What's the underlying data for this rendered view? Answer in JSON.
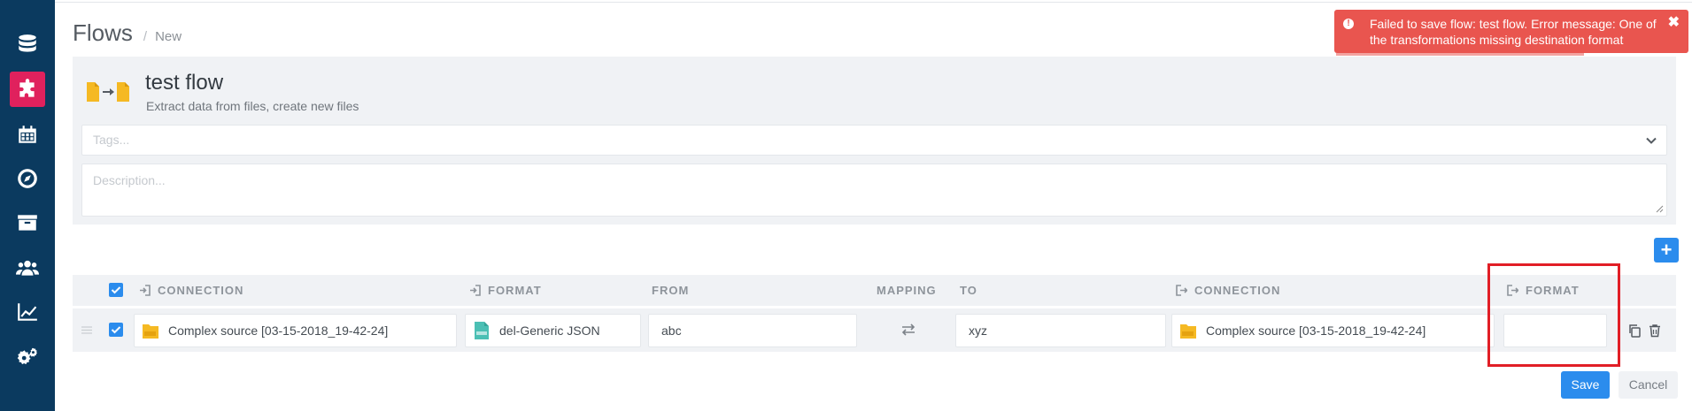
{
  "breadcrumb": {
    "title": "Flows",
    "separator": "/",
    "current": "New"
  },
  "toast": {
    "message": "Failed to save flow: test flow. Error message: One of the transformations missing destination format",
    "icon": "alert-circle-icon",
    "close_label": "✖",
    "color": "#e9554f"
  },
  "sidebar": {
    "items": [
      {
        "name": "database-icon",
        "active": false
      },
      {
        "name": "puzzle-icon",
        "active": true
      },
      {
        "name": "calendar-icon",
        "active": false
      },
      {
        "name": "compass-icon",
        "active": false
      },
      {
        "name": "archive-icon",
        "active": false
      },
      {
        "name": "users-icon",
        "active": false
      },
      {
        "name": "chart-line-icon",
        "active": false
      },
      {
        "name": "gears-icon",
        "active": false
      }
    ],
    "color": "#0b3a5f",
    "active_color": "#e0215d"
  },
  "flow": {
    "name": "test flow",
    "description": "Extract data from files, create new files",
    "tags_placeholder": "Tags...",
    "description_placeholder": "Description..."
  },
  "table": {
    "headers": {
      "source_connection": "CONNECTION",
      "source_format": "FORMAT",
      "from": "FROM",
      "mapping": "MAPPING",
      "to": "TO",
      "dest_connection": "CONNECTION",
      "dest_format": "FORMAT"
    },
    "rows": [
      {
        "checked": true,
        "source_connection": "Complex source [03-15-2018_19-42-24]",
        "source_format": "del-Generic JSON",
        "from": "abc",
        "to": "xyz",
        "dest_connection": "Complex source [03-15-2018_19-42-24]",
        "dest_format": ""
      }
    ]
  },
  "buttons": {
    "add": "+",
    "save": "Save",
    "cancel": "Cancel"
  },
  "colors": {
    "primary": "#2b8ced",
    "highlight": "#e11e26",
    "folder": "#f5b923",
    "json_file": "#4bbfb4"
  }
}
